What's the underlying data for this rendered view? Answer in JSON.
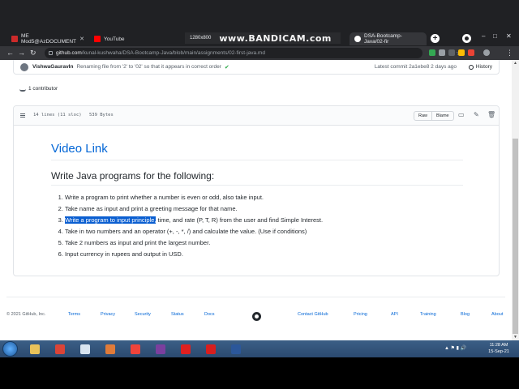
{
  "browser": {
    "tabs": [
      {
        "label": "ME Mod5@AzDOCUMENT",
        "favicon_color": "#cc2a2a",
        "active": false
      },
      {
        "label": "YouTube",
        "favicon_color": "#ff0000",
        "active": false
      },
      {
        "label": "DSA-Bootcamp-Java/02-fir",
        "favicon_color": "#ffffff",
        "active": true
      }
    ],
    "new_tab_glyph": "+",
    "url_host": "github.com",
    "url_path": "/kunal-kushwaha/DSA-Bootcamp-Java/blob/main/assignments/02-first-java.md",
    "window_controls": [
      "–",
      "□",
      "✕"
    ]
  },
  "recorder_overlay": {
    "resolution": "1280x800",
    "brand": "www.BANDICAM.com"
  },
  "commit": {
    "author": "VishwaGauravIn",
    "message": "Renaming file from '2' to '02' so that it appears in correct order",
    "latest": "Latest commit 2a1ebe8 2 days ago",
    "history_label": "History"
  },
  "contributors": "1 contributor",
  "file": {
    "lines": "14 lines (11 sloc)",
    "size": "539 Bytes",
    "raw_label": "Raw",
    "blame_label": "Blame"
  },
  "markdown": {
    "h1": "Video Link",
    "h2": "Write Java programs for the following:",
    "items": [
      {
        "text": "Write a program to print whether a number is even or odd, also take input."
      },
      {
        "text": "Take name as input and print a greeting message for that name."
      },
      {
        "highlight": "Write a program to input principle,",
        "text": " time, and rate (P, T, R) from the user and find Simple Interest."
      },
      {
        "text": "Take in two numbers and an operator (+, -, *, /) and calculate the value. (Use if conditions)"
      },
      {
        "text": "Take 2 numbers as input and print the largest number."
      },
      {
        "text": "Input currency in rupees and output in USD."
      }
    ]
  },
  "footer": {
    "copyright": "© 2021 GitHub, Inc.",
    "links_left": [
      "Terms",
      "Privacy",
      "Security",
      "Status",
      "Docs"
    ],
    "links_right": [
      "Contact GitHub",
      "Pricing",
      "API",
      "Training",
      "Blog",
      "About"
    ]
  },
  "taskbar": {
    "time": "11:28 AM",
    "date": "15-Sep-21",
    "apps": [
      {
        "name": "file-explorer-icon",
        "color": "#e8c25a"
      },
      {
        "name": "chrome-icon",
        "color": "#db4437"
      },
      {
        "name": "notepad-icon",
        "color": "#d8e4f0"
      },
      {
        "name": "paint-icon",
        "color": "#e07b39"
      },
      {
        "name": "anydesk-icon",
        "color": "#ef443b"
      },
      {
        "name": "winrar-icon",
        "color": "#7b3f9e"
      },
      {
        "name": "bandicam-icon",
        "color": "#e02020"
      },
      {
        "name": "acrobat-icon",
        "color": "#d81e1e"
      },
      {
        "name": "word-icon",
        "color": "#2b579a"
      }
    ]
  }
}
